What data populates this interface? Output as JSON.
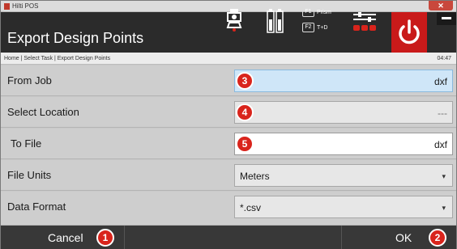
{
  "window": {
    "title": "Hilti POS"
  },
  "header": {
    "title": "Export Design Points",
    "fkeys": [
      {
        "key": "F1",
        "label": "Prism"
      },
      {
        "key": "F2",
        "label": "T+D"
      }
    ]
  },
  "breadcrumb": {
    "text": "Home | Select Task | Export Design Points",
    "time": "04:47"
  },
  "form": {
    "from_job": {
      "label": "From Job",
      "value": "dxf",
      "badge": "3"
    },
    "select_location": {
      "label": "Select Location",
      "value": "---",
      "badge": "4"
    },
    "to_file": {
      "label": "To File",
      "value": "dxf",
      "badge": "5"
    },
    "file_units": {
      "label": "File Units",
      "value": "Meters"
    },
    "data_format": {
      "label": "Data Format",
      "value": "*.csv"
    }
  },
  "footer": {
    "cancel": {
      "label": "Cancel",
      "badge": "1"
    },
    "ok": {
      "label": "OK",
      "badge": "2"
    }
  },
  "colors": {
    "accent_red": "#d9241c",
    "header_bg": "#2b2b2b",
    "highlight_field": "#cfe6f8"
  }
}
